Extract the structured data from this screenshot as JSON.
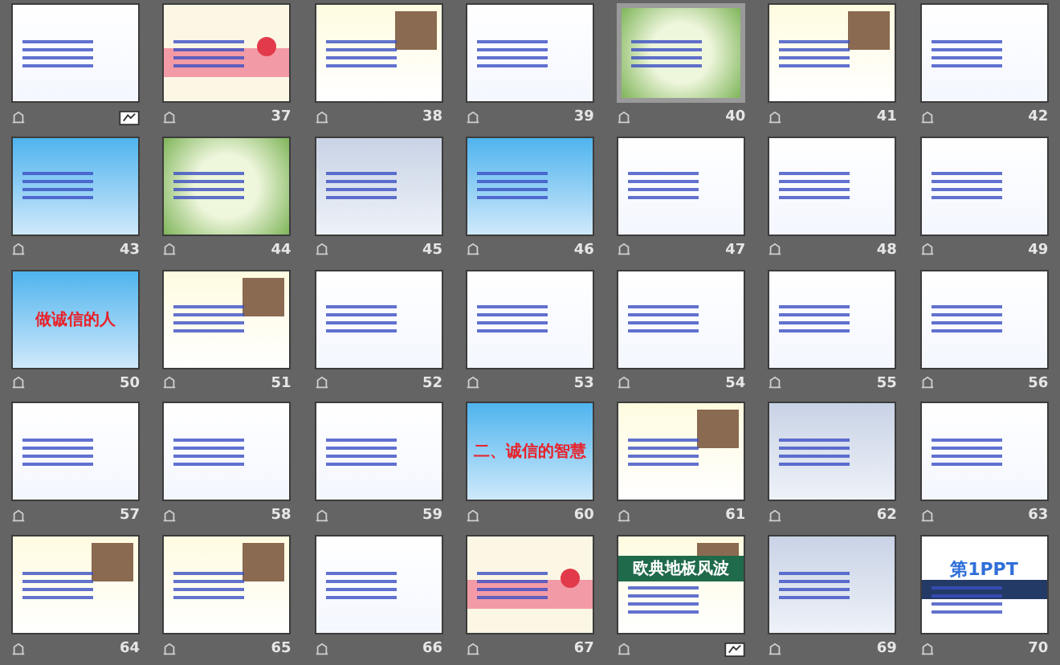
{
  "slides": [
    {
      "kind": "text",
      "selected": false,
      "media": true
    },
    {
      "number": "37",
      "kind": "cartoon",
      "selected": false
    },
    {
      "number": "38",
      "kind": "photo",
      "selected": false
    },
    {
      "number": "39",
      "kind": "text",
      "selected": false
    },
    {
      "number": "40",
      "kind": "green",
      "selected": true
    },
    {
      "number": "41",
      "kind": "photo",
      "selected": false
    },
    {
      "number": "42",
      "kind": "text",
      "selected": false
    },
    {
      "number": "43",
      "kind": "sky",
      "selected": false
    },
    {
      "number": "44",
      "kind": "green",
      "selected": false
    },
    {
      "number": "45",
      "kind": "blue",
      "selected": false
    },
    {
      "number": "46",
      "kind": "sky",
      "selected": false
    },
    {
      "number": "47",
      "kind": "text",
      "selected": false
    },
    {
      "number": "48",
      "kind": "text",
      "selected": false
    },
    {
      "number": "49",
      "kind": "text",
      "selected": false
    },
    {
      "number": "50",
      "kind": "sky",
      "selected": false,
      "title": "做诚信的人"
    },
    {
      "number": "51",
      "kind": "photo",
      "selected": false
    },
    {
      "number": "52",
      "kind": "text",
      "selected": false
    },
    {
      "number": "53",
      "kind": "text",
      "selected": false
    },
    {
      "number": "54",
      "kind": "text",
      "selected": false
    },
    {
      "number": "55",
      "kind": "text",
      "selected": false
    },
    {
      "number": "56",
      "kind": "text",
      "selected": false
    },
    {
      "number": "57",
      "kind": "text",
      "selected": false
    },
    {
      "number": "58",
      "kind": "text",
      "selected": false
    },
    {
      "number": "59",
      "kind": "text",
      "selected": false
    },
    {
      "number": "60",
      "kind": "sky",
      "selected": false,
      "title": "二、诚信的智慧"
    },
    {
      "number": "61",
      "kind": "photo",
      "selected": false
    },
    {
      "number": "62",
      "kind": "blue",
      "selected": false
    },
    {
      "number": "63",
      "kind": "text",
      "selected": false
    },
    {
      "number": "64",
      "kind": "photo",
      "selected": false
    },
    {
      "number": "65",
      "kind": "photo",
      "selected": false
    },
    {
      "number": "66",
      "kind": "text",
      "selected": false
    },
    {
      "number": "67",
      "kind": "cartoon",
      "selected": false
    },
    {
      "kind": "photo",
      "selected": false,
      "media": true,
      "title": "欧典地板风波"
    },
    {
      "number": "69",
      "kind": "blue",
      "selected": false
    },
    {
      "number": "70",
      "kind": "brand",
      "selected": false,
      "title": "第1PPT"
    }
  ]
}
